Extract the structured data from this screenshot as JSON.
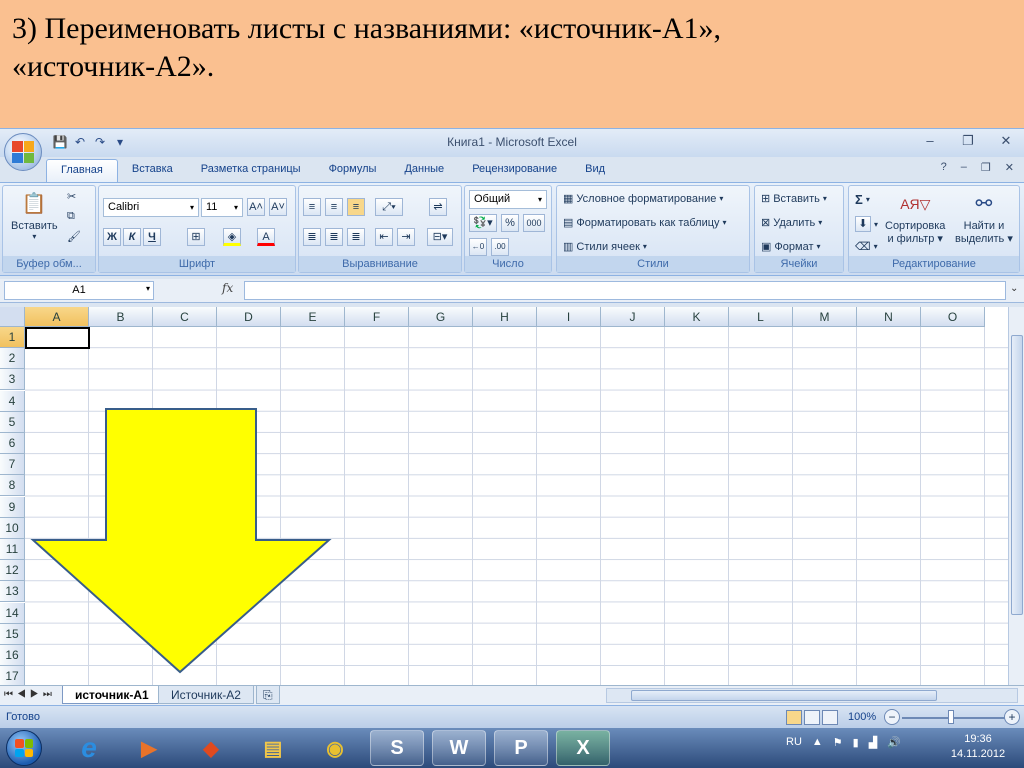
{
  "slide": {
    "title_line1": "3) Переименовать листы с названиями: «источник-А1»,",
    "title_line2": "«источник-А2»."
  },
  "window": {
    "title": "Книга1 - Microsoft Excel",
    "controls": [
      "–",
      "❐",
      "✕"
    ],
    "doc_controls": [
      "?",
      "–",
      "❐",
      "✕"
    ]
  },
  "tabs": [
    "Главная",
    "Вставка",
    "Разметка страницы",
    "Формулы",
    "Данные",
    "Рецензирование",
    "Вид"
  ],
  "ribbon": {
    "clipboard": {
      "paste": "Вставить",
      "label": "Буфер обм..."
    },
    "font": {
      "name": "Calibri",
      "size": "11",
      "bold": "Ж",
      "italic": "К",
      "underline": "Ч",
      "label": "Шрифт"
    },
    "alignment": {
      "label": "Выравнивание"
    },
    "number": {
      "format": "Общий",
      "percent": "%",
      "thousands": "000",
      "label": "Число"
    },
    "styles": {
      "conditional": "Условное форматирование",
      "as_table": "Форматировать как таблицу",
      "cell_styles": "Стили ячеек",
      "label": "Стили"
    },
    "cells": {
      "insert": "Вставить",
      "delete": "Удалить",
      "format": "Формат",
      "label": "Ячейки"
    },
    "editing": {
      "sigma": "Σ",
      "sort_line1": "Сортировка",
      "sort_line2": "и фильтр",
      "find_line1": "Найти и",
      "find_line2": "выделить",
      "label": "Редактирование"
    }
  },
  "formula_bar": {
    "name_box": "A1",
    "fx": "fx",
    "value": ""
  },
  "grid": {
    "columns": [
      "A",
      "B",
      "C",
      "D",
      "E",
      "F",
      "G",
      "H",
      "I",
      "J",
      "K",
      "L",
      "M",
      "N",
      "O"
    ],
    "rows": [
      "1",
      "2",
      "3",
      "4",
      "5",
      "6",
      "7",
      "8",
      "9",
      "10",
      "11",
      "12",
      "13",
      "14",
      "15",
      "16",
      "17"
    ],
    "active_cell": "A1"
  },
  "sheet_tabs": {
    "tab1": "источник-А1",
    "tab2": "Источник-А2"
  },
  "status": {
    "text": "Готово",
    "zoom": "100%",
    "minus": "−",
    "plus": "+"
  },
  "taskbar": {
    "lang": "RU",
    "time": "19:36",
    "date": "14.11.2012"
  },
  "colors": {
    "slide_bg": "#fac090",
    "arrow_fill": "#ffff00",
    "arrow_stroke": "#385d8a"
  }
}
